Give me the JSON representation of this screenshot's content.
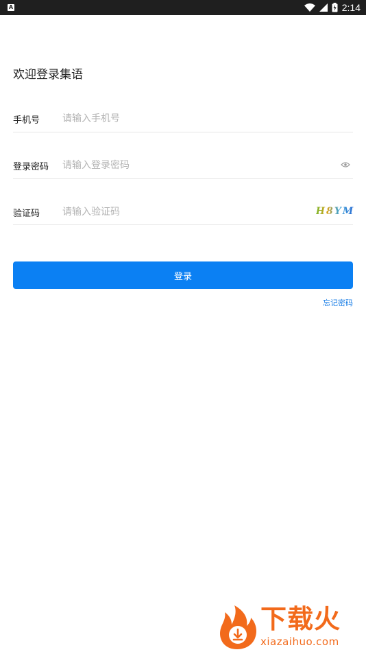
{
  "status_bar": {
    "time": "2:14",
    "app_icon": "A"
  },
  "page": {
    "welcome": "欢迎登录集语"
  },
  "form": {
    "phone": {
      "label": "手机号",
      "placeholder": "请输入手机号"
    },
    "password": {
      "label": "登录密码",
      "placeholder": "请输入登录密码",
      "icon": "eye-icon"
    },
    "captcha": {
      "label": "验证码",
      "placeholder": "请输入验证码",
      "image_text": "H8YM"
    }
  },
  "actions": {
    "login_label": "登录",
    "forgot_label": "忘记密码"
  },
  "watermark": {
    "title": "下载火",
    "url": "xiazaihuo.com"
  },
  "colors": {
    "accent": "#0b80f3",
    "link": "#1a7ee6",
    "placeholder": "#b3b3b3",
    "watermark": "#f26a1b"
  }
}
